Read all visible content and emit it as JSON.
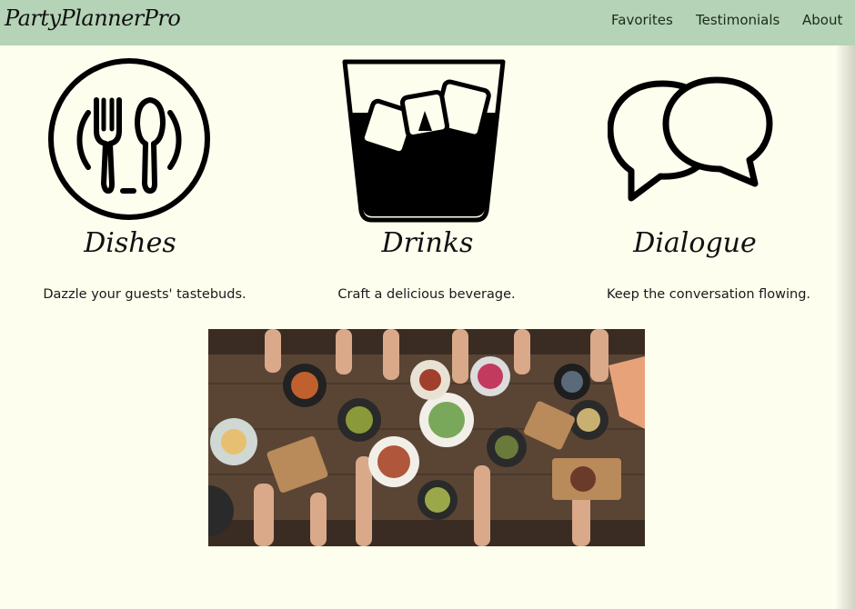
{
  "navbar": {
    "brand": "PartyPlannerPro",
    "links": [
      "Favorites",
      "Testimonials",
      "About"
    ],
    "background_color": "#b5d3b6"
  },
  "features": [
    {
      "icon": "fork-spoon-plate-icon",
      "title": "Dishes",
      "description": "Dazzle your guests' tastebuds."
    },
    {
      "icon": "ice-drink-glass-icon",
      "title": "Drinks",
      "description": "Craft a delicious beverage."
    },
    {
      "icon": "speech-bubbles-icon",
      "title": "Dialogue",
      "description": "Keep the conversation flowing."
    }
  ],
  "hero": {
    "image": "party-table-photo"
  },
  "colors": {
    "page_background": "#fdfeee",
    "icon_color": "#000000"
  }
}
